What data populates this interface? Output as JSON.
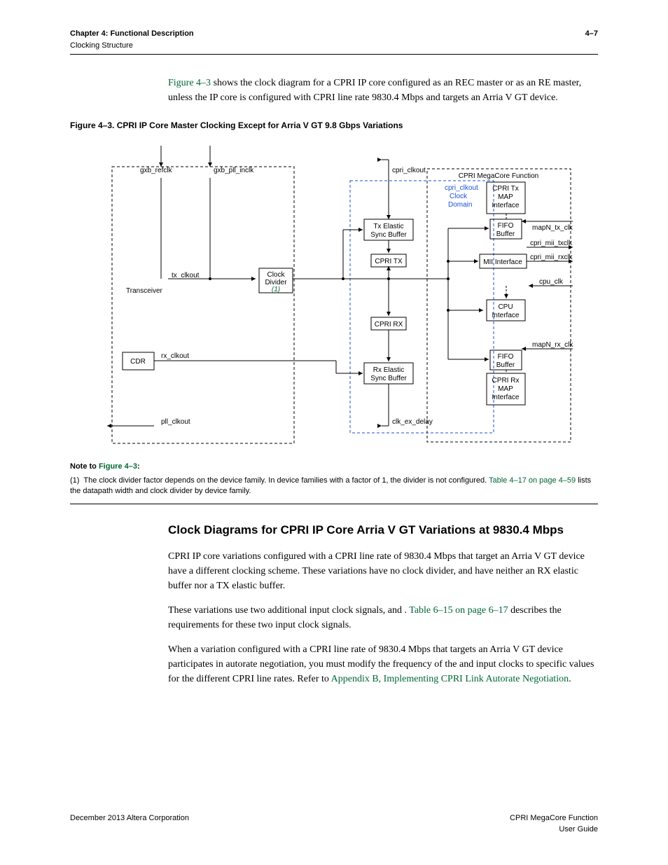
{
  "header": {
    "chapter": "Chapter 4: Functional Description",
    "section": "Clocking Structure",
    "page": "4–7"
  },
  "intro": {
    "link": "Figure 4–3",
    "rest": " shows the clock diagram for a CPRI IP core configured as an REC master or as an RE master, unless the IP core is configured with CPRI line rate 9830.4 Mbps and targets an Arria V GT device."
  },
  "figure_caption": "Figure 4–3. CPRI IP Core Master Clocking Except for Arria V GT 9.8 Gbps Variations",
  "diagram": {
    "gxb_refclk": "gxb_refclk",
    "gxb_pll_inclk": "gxb_pll_inclk",
    "cpri_clkout": "cpri_clkout",
    "megacore": "CPRI MegaCore Function",
    "clkout_domain_l1": "cpri_clkout",
    "clkout_domain_l2": "Clock",
    "clkout_domain_l3": "Domain",
    "tx_map_l1": "CPRI Tx",
    "tx_map_l2": "MAP",
    "tx_map_l3": "Interface",
    "tx_elastic_l1": "Tx Elastic",
    "tx_elastic_l2": "Sync Buffer",
    "fifo_l1": "FIFO",
    "fifo_l2": "Buffer",
    "mapN_tx_clk": "mapN_tx_clk",
    "tx_clkout": "tx_clkout",
    "clock_div_l1": "Clock",
    "clock_div_l2": "Divider",
    "clock_div_note": "(1)",
    "cpri_tx": "CPRI TX",
    "mii_interface": "MII Interface",
    "cpri_mii_txclk": "cpri_mii_txclk",
    "cpri_mii_rxclk": "cpri_mii_rxclk",
    "transceiver": "Transceiver",
    "cpu_clk": "cpu_clk",
    "cpu_l1": "CPU",
    "cpu_l2": "Interface",
    "cpri_rx": "CPRI RX",
    "mapN_rx_clk": "mapN_rx_clk",
    "cdr": "CDR",
    "rx_clkout": "rx_clkout",
    "rx_elastic_l1": "Rx Elastic",
    "rx_elastic_l2": "Sync Buffer",
    "rx_map_l1": "CPRI Rx",
    "rx_map_l2": "MAP",
    "rx_map_l3": "Interface",
    "pll_clkout": "pll_clkout",
    "clk_ex_delay": "clk_ex_delay"
  },
  "note": {
    "title_prefix": "Note to ",
    "title_link": "Figure 4–3",
    "title_suffix": ":",
    "num": "(1)",
    "text1": "The clock divider factor depends on the device family. In device families with a factor of 1, the divider is not configured. ",
    "link": "Table 4–17 on page 4–59",
    "text2": " lists the datapath width and clock divider by device family."
  },
  "section_title": "Clock Diagrams for CPRI IP Core Arria V GT Variations at 9830.4 Mbps",
  "para1": "CPRI IP core variations configured with a CPRI line rate of 9830.4 Mbps that target an Arria V GT device have a different clocking scheme. These variations have no clock divider, and have neither an RX elastic buffer nor a TX elastic buffer.",
  "para2_a": "These variations use two additional input clock signals, ",
  "para2_b": " and ",
  "para2_c": ". ",
  "para2_link": "Table 6–15 on page 6–17",
  "para2_d": " describes the requirements for these two input clock signals.",
  "para3_a": "When a variation configured with a CPRI line rate of 9830.4 Mbps that targets an Arria V GT device participates in autorate negotiation, you must modify the frequency of the ",
  "para3_b": " and ",
  "para3_c": " input clocks to specific values for the different CPRI line rates. Refer to ",
  "para3_link": "Appendix B, Implementing CPRI Link Autorate Negotiation",
  "para3_d": ".",
  "footer": {
    "left": "December 2013   Altera Corporation",
    "right1": "CPRI MegaCore Function",
    "right2": "User Guide"
  }
}
